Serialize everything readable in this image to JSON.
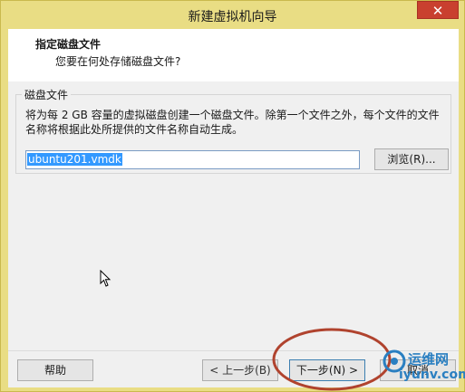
{
  "window": {
    "title": "新建虚拟机向导",
    "close_glyph": "✕"
  },
  "header": {
    "title": "指定磁盘文件",
    "subtitle": "您要在何处存储磁盘文件?"
  },
  "disk_file_group": {
    "label": "磁盘文件",
    "description": "将为每 2 GB 容量的虚拟磁盘创建一个磁盘文件。除第一个文件之外，每个文件的文件名称将根据此处所提供的文件名称自动生成。",
    "filename_value": "ubuntu201.vmdk",
    "browse_label": "浏览(R)..."
  },
  "footer": {
    "help_label": "帮助",
    "back_label": "< 上一步(B)",
    "next_label": "下一步(N) >",
    "cancel_label": "取消"
  },
  "watermark": {
    "line1": "运维网",
    "line2": "iyunv.com"
  },
  "colors": {
    "title_bar": "#e9dd84",
    "close_button": "#c9402f",
    "annotation": "#b0432e",
    "watermark": "#2a7fc1"
  }
}
